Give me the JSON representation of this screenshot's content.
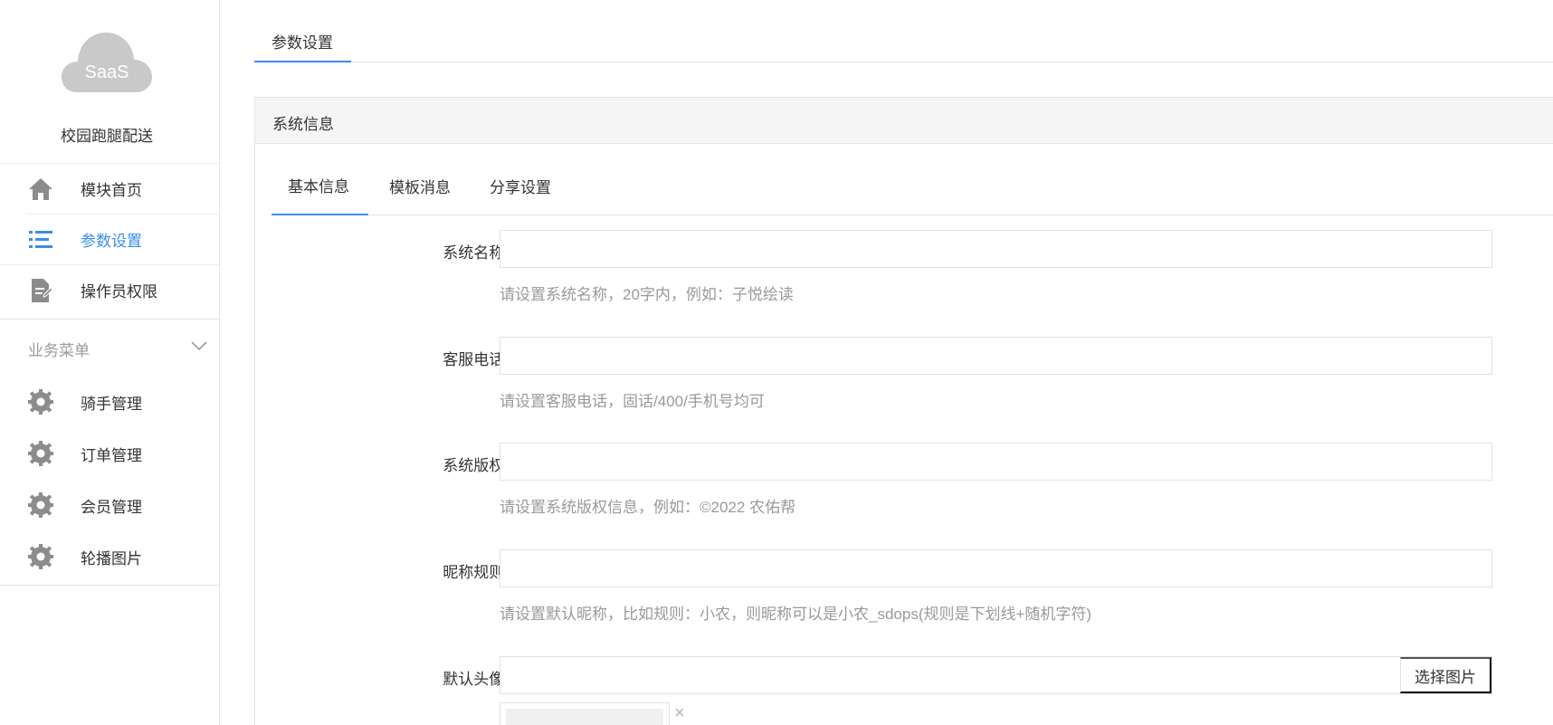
{
  "sidebar": {
    "logo_text": "SaaS",
    "app_name": "校园跑腿配送",
    "nav": [
      {
        "label": "模块首页",
        "icon": "home-icon",
        "active": false
      },
      {
        "label": "参数设置",
        "icon": "list-icon",
        "active": true
      },
      {
        "label": "操作员权限",
        "icon": "document-edit-icon",
        "active": false
      }
    ],
    "business_menu": {
      "label": "业务菜单",
      "items": [
        {
          "label": "骑手管理",
          "icon": "gear-icon"
        },
        {
          "label": "订单管理",
          "icon": "gear-icon"
        },
        {
          "label": "会员管理",
          "icon": "gear-icon"
        },
        {
          "label": "轮播图片",
          "icon": "gear-icon"
        }
      ]
    }
  },
  "top_tab": {
    "label": "参数设置"
  },
  "panel": {
    "title": "系统信息",
    "subtabs": [
      {
        "label": "基本信息",
        "active": true
      },
      {
        "label": "模板消息",
        "active": false
      },
      {
        "label": "分享设置",
        "active": false
      }
    ],
    "form": {
      "system_name": {
        "label": "系统名称:",
        "value": "",
        "hint": "请设置系统名称，20字内，例如：子悦绘读"
      },
      "service_phone": {
        "label": "客服电话:",
        "value": "",
        "hint": "请设置客服电话，固话/400/手机号均可"
      },
      "copyright": {
        "label": "系统版权:",
        "value": "",
        "hint": "请设置系统版权信息，例如：©2022 农佑帮"
      },
      "nickname_rule": {
        "label": "昵称规则:",
        "value": "",
        "hint": "请设置默认昵称，比如规则：小农，则昵称可以是小农_sdops(规则是下划线+随机字符)"
      },
      "default_avatar": {
        "label": "默认头像:",
        "value": "",
        "button": "选择图片",
        "remove": "×"
      }
    }
  },
  "colors": {
    "accent": "#3a8ee6",
    "icon_gray": "#8c8c8c",
    "hint_gray": "#999999",
    "border": "#e2e2e2",
    "panel_head_bg": "#f5f5f5"
  }
}
